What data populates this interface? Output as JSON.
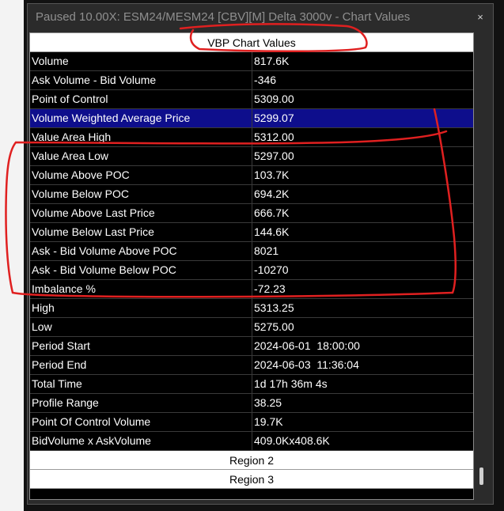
{
  "window": {
    "title": "Paused 10.00X: ESM24/MESM24 [CBV][M]  Delta 3000v - Chart Values",
    "close_glyph": "×"
  },
  "section_header": "VBP Chart Values",
  "rows": [
    {
      "label": "Volume",
      "value": "817.6K"
    },
    {
      "label": "Ask Volume - Bid Volume",
      "value": "-346"
    },
    {
      "label": "Point of Control",
      "value": "5309.00"
    },
    {
      "label": "Volume Weighted Average Price",
      "value": "5299.07"
    },
    {
      "label": "Value Area High",
      "value": "5312.00"
    },
    {
      "label": "Value Area Low",
      "value": "5297.00"
    },
    {
      "label": "Volume Above POC",
      "value": "103.7K"
    },
    {
      "label": "Volume Below POC",
      "value": "694.2K"
    },
    {
      "label": "Volume Above Last Price",
      "value": "666.7K"
    },
    {
      "label": "Volume Below Last Price",
      "value": "144.6K"
    },
    {
      "label": "Ask - Bid Volume Above POC",
      "value": "8021"
    },
    {
      "label": "Ask - Bid Volume Below POC",
      "value": "-10270"
    },
    {
      "label": "Imbalance %",
      "value": "-72.23"
    },
    {
      "label": "High",
      "value": "5313.25"
    },
    {
      "label": "Low",
      "value": "5275.00"
    },
    {
      "label": "Period Start",
      "value": "2024-06-01  18:00:00"
    },
    {
      "label": "Period End",
      "value": "2024-06-03  11:36:04"
    },
    {
      "label": "Total Time",
      "value": "1d 17h 36m 4s"
    },
    {
      "label": "Profile Range",
      "value": "38.25"
    },
    {
      "label": "Point Of Control Volume",
      "value": "19.7K"
    },
    {
      "label": "BidVolume x AskVolume",
      "value": "409.0Kx408.6K"
    }
  ],
  "selected_row": "Volume Weighted Average Price",
  "regions": [
    {
      "label": "Region 2"
    },
    {
      "label": "Region 3"
    }
  ],
  "colors": {
    "selection": "#0e0e8c",
    "annotation": "#e02020",
    "table_bg": "#000000",
    "header_bg": "#ffffff"
  },
  "icons": {
    "close": "close-icon"
  }
}
